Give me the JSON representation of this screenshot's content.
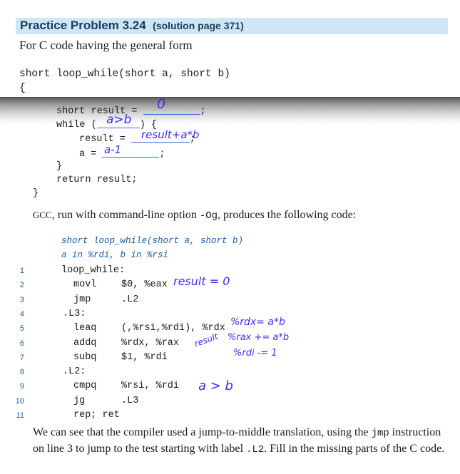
{
  "header": {
    "title": "Practice Problem 3.24",
    "solution_ref": "(solution page 371)"
  },
  "intro": "For C code having the general form",
  "c_code": {
    "signature": "short loop_while(short a, short b)",
    "open_brace": "{",
    "line_result_init": "short result = ",
    "line_result_semicolon": ";",
    "while_open": "while (",
    "while_close": ") {",
    "result_assign": "result = ",
    "result_semicolon": ";",
    "a_assign": "a = ",
    "a_semicolon": ";",
    "inner_close": "}",
    "return_stmt": "return result;",
    "outer_close": "}"
  },
  "handwriting": {
    "init_value": "0",
    "condition": "a>b",
    "result_expr": "result+a*b",
    "a_expr": "a-1",
    "note_movl": "result = 0",
    "note_leaq": "%rdx= a*b",
    "note_result_word": "result",
    "note_addq": "%rax += a*b",
    "note_subq": "%rdi -= 1",
    "note_cmpq": "a > b"
  },
  "gcc_intro": {
    "prefix": "GCC",
    "middle": ", run with command-line option ",
    "option": "-Og",
    "suffix": ", produces the following code:"
  },
  "assembly": {
    "comment1": "short loop_while(short a, short b)",
    "comment2": "a in %rdi, b in %rsi",
    "lines": [
      {
        "n": "1",
        "label": "loop_while:",
        "op": "",
        "args": ""
      },
      {
        "n": "2",
        "label": "",
        "op": "movl",
        "args": "$0, %eax"
      },
      {
        "n": "3",
        "label": "",
        "op": "jmp",
        "args": ".L2"
      },
      {
        "n": "4",
        "label": ".L3:",
        "op": "",
        "args": ""
      },
      {
        "n": "5",
        "label": "",
        "op": "leaq",
        "args": "(,%rsi,%rdi), %rdx"
      },
      {
        "n": "6",
        "label": "",
        "op": "addq",
        "args": "%rdx, %rax"
      },
      {
        "n": "7",
        "label": "",
        "op": "subq",
        "args": "$1, %rdi"
      },
      {
        "n": "8",
        "label": ".L2:",
        "op": "",
        "args": ""
      },
      {
        "n": "9",
        "label": "",
        "op": "cmpq",
        "args": "%rsi, %rdi"
      },
      {
        "n": "10",
        "label": "",
        "op": "jg",
        "args": ".L3"
      },
      {
        "n": "11",
        "label": "",
        "op": "rep; ret",
        "args": ""
      }
    ]
  },
  "closing": {
    "part1": "We can see that the compiler used a jump-to-middle translation, using the ",
    "code1": "jmp",
    "part2": " instruction on line 3 to jump to the test starting with label ",
    "code2": ".L2",
    "part3": ". Fill in the missing parts of the C code."
  }
}
